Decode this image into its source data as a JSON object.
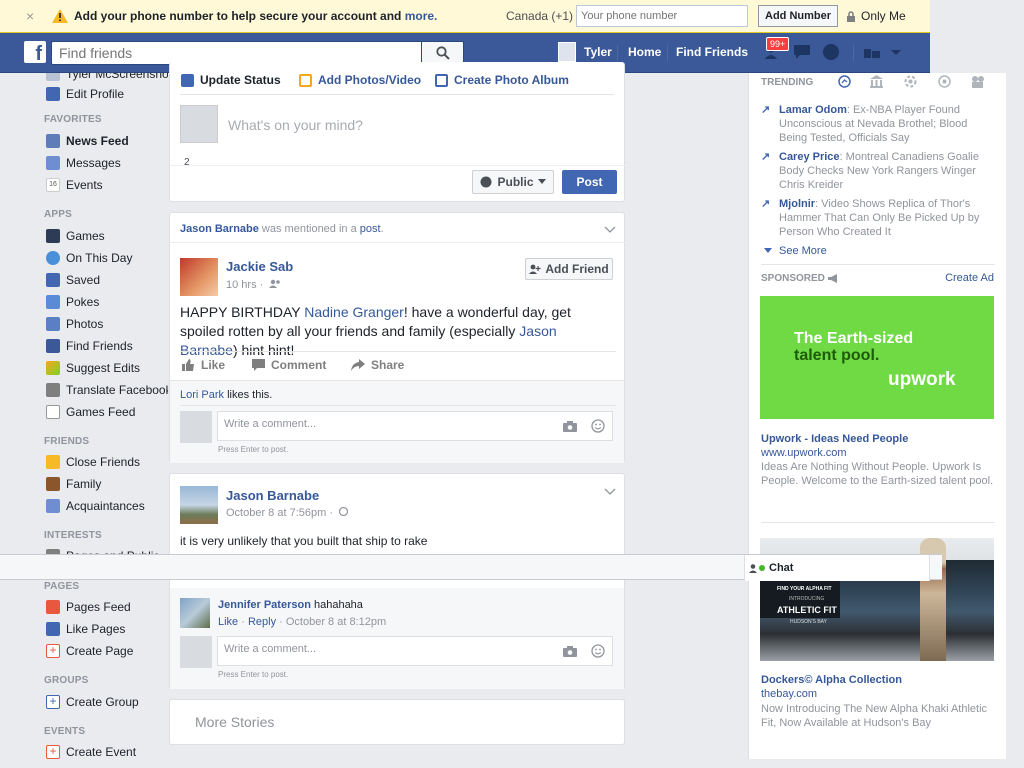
{
  "notification": {
    "close": "×",
    "message": "Add your phone number to help secure your account and ",
    "more_link": "more.",
    "country": "Canada (+1)",
    "phone_placeholder": "Your phone number",
    "add_button": "Add Number",
    "privacy": "Only Me"
  },
  "header": {
    "logo": "f",
    "search_placeholder": "Find friends",
    "user_name": "Tyler",
    "home": "Home",
    "find_friends": "Find Friends",
    "notification_badge": "99+"
  },
  "left_nav": {
    "top_item": "Tyler McScreenshots",
    "edit_profile": "Edit Profile",
    "sections": {
      "favorites": "FAVORITES",
      "apps": "APPS",
      "friends": "FRIENDS",
      "interests": "INTERESTS",
      "pages": "PAGES",
      "groups": "GROUPS",
      "events": "EVENTS"
    },
    "favorites": [
      "News Feed",
      "Messages",
      "Events"
    ],
    "events_icon_num": "16",
    "apps": [
      "Games",
      "On This Day",
      "Saved",
      "Pokes",
      "Photos",
      "Find Friends",
      "Suggest Edits",
      "Translate Facebook",
      "Games Feed"
    ],
    "friends": [
      "Close Friends",
      "Family",
      "Acquaintances"
    ],
    "interests": [
      "Pages and Public"
    ],
    "pages": [
      "Pages Feed",
      "Like Pages",
      "Create Page"
    ],
    "groups": [
      "Create Group"
    ],
    "events": [
      "Create Event"
    ]
  },
  "composer": {
    "tab_status": "Update Status",
    "tab_photo": "Add Photos/Video",
    "tab_album": "Create Photo Album",
    "placeholder": "What's on your mind?",
    "count": "2",
    "audience": "Public",
    "post_button": "Post"
  },
  "post1": {
    "mention_name": "Jason Barnabe",
    "mention_text": " was mentioned in a ",
    "mention_link": "post",
    "mention_end": ".",
    "author": "Jackie Sab",
    "time": "10 hrs ·",
    "add_friend": "Add Friend",
    "text_1": "HAPPY BIRTHDAY ",
    "tag_1": "Nadine Granger",
    "text_2": "! have a wonderful day, get spoiled rotten by all your friends and family (especially ",
    "tag_2": "Jason Barnabe",
    "text_3": ") hint hint!",
    "like": "Like",
    "comment": "Comment",
    "share": "Share",
    "liker": "Lori Park",
    "likes_text": " likes this.",
    "comment_placeholder": "Write a comment...",
    "press_enter": "Press Enter to post."
  },
  "post2": {
    "author": "Jason Barnabe",
    "time": "October 8 at 7:56pm ·",
    "text": "it is very unlikely that you built that ship to rake",
    "reply_author": "Jennifer Paterson",
    "reply_text": " hahahaha",
    "reply_like": "Like",
    "reply_reply": "Reply",
    "reply_time": " · October 8 at 8:12pm",
    "comment_placeholder": "Write a comment...",
    "press_enter": "Press Enter to post."
  },
  "more_stories": "More Stories",
  "trending": {
    "label": "TRENDING",
    "items": [
      {
        "name": "Lamar Odom",
        "text": ": Ex-NBA Player Found Unconscious at Nevada Brothel; Blood Being Tested, Officials Say"
      },
      {
        "name": "Carey Price",
        "text": ": Montreal Canadiens Goalie Body Checks New York Rangers Winger Chris Kreider"
      },
      {
        "name": "Mjolnir",
        "text": ": Video Shows Replica of Thor's Hammer That Can Only Be Picked Up by Person Who Created It"
      }
    ],
    "see_more": "See More"
  },
  "sponsored": {
    "label": "SPONSORED",
    "create_ad": "Create Ad",
    "ad1": {
      "image_line1": "The Earth-sized",
      "image_line2": "talent pool.",
      "image_brand": "upwork",
      "title": "Upwork - Ideas Need People",
      "url": "www.upwork.com",
      "desc": "Ideas Are Nothing Without People. Upwork Is People. Welcome to the Earth-sized talent pool."
    },
    "ad2": {
      "img_line1": "FIND YOUR ALPHA FIT",
      "img_line2": "INTRODUCING",
      "img_line3": "ATHLETIC FIT",
      "img_line4": "HUDSON'S BAY",
      "title": "Dockers© Alpha Collection",
      "url": "thebay.com",
      "desc": "Now Introducing The New Alpha Khaki Athletic Fit, Now Available at Hudson's Bay"
    }
  },
  "chat": {
    "label": "Chat"
  }
}
